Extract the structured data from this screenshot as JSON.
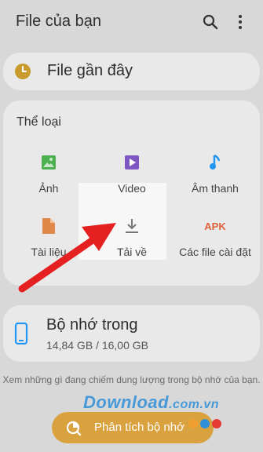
{
  "appbar": {
    "title": "File của bạn",
    "search_icon": "search-icon",
    "more_icon": "more-vert-icon"
  },
  "recent": {
    "label": "File gần đây",
    "icon": "clock-icon",
    "icon_color": "#c89b2c"
  },
  "categories": {
    "title": "Thể loại",
    "items": [
      {
        "label": "Ảnh",
        "icon": "image-icon",
        "color": "#4caf50"
      },
      {
        "label": "Video",
        "icon": "video-icon",
        "color": "#7e57c2"
      },
      {
        "label": "Âm thanh",
        "icon": "music-note-icon",
        "color": "#2196f3"
      },
      {
        "label": "Tài liệu",
        "icon": "document-icon",
        "color": "#e0884a"
      },
      {
        "label": "Tải về",
        "icon": "download-icon",
        "color": "#777777"
      },
      {
        "label": "Các file cài đặt",
        "icon": "apk-icon",
        "color": "#e0603a",
        "icon_text": "APK"
      }
    ]
  },
  "storage": {
    "title": "Bộ nhớ trong",
    "size": "14,84 GB / 16,00 GB",
    "icon": "phone-icon",
    "icon_color": "#2196f3"
  },
  "hint": "Xem những gì đang chiếm dung lượng trong bộ nhớ của bạn.",
  "analyze": {
    "label": "Phân tích bộ nhớ",
    "icon": "analyze-icon"
  },
  "watermark": {
    "text": "Download",
    "suffix": ".com.vn"
  },
  "annotation": {
    "arrow_color": "#e52020"
  }
}
